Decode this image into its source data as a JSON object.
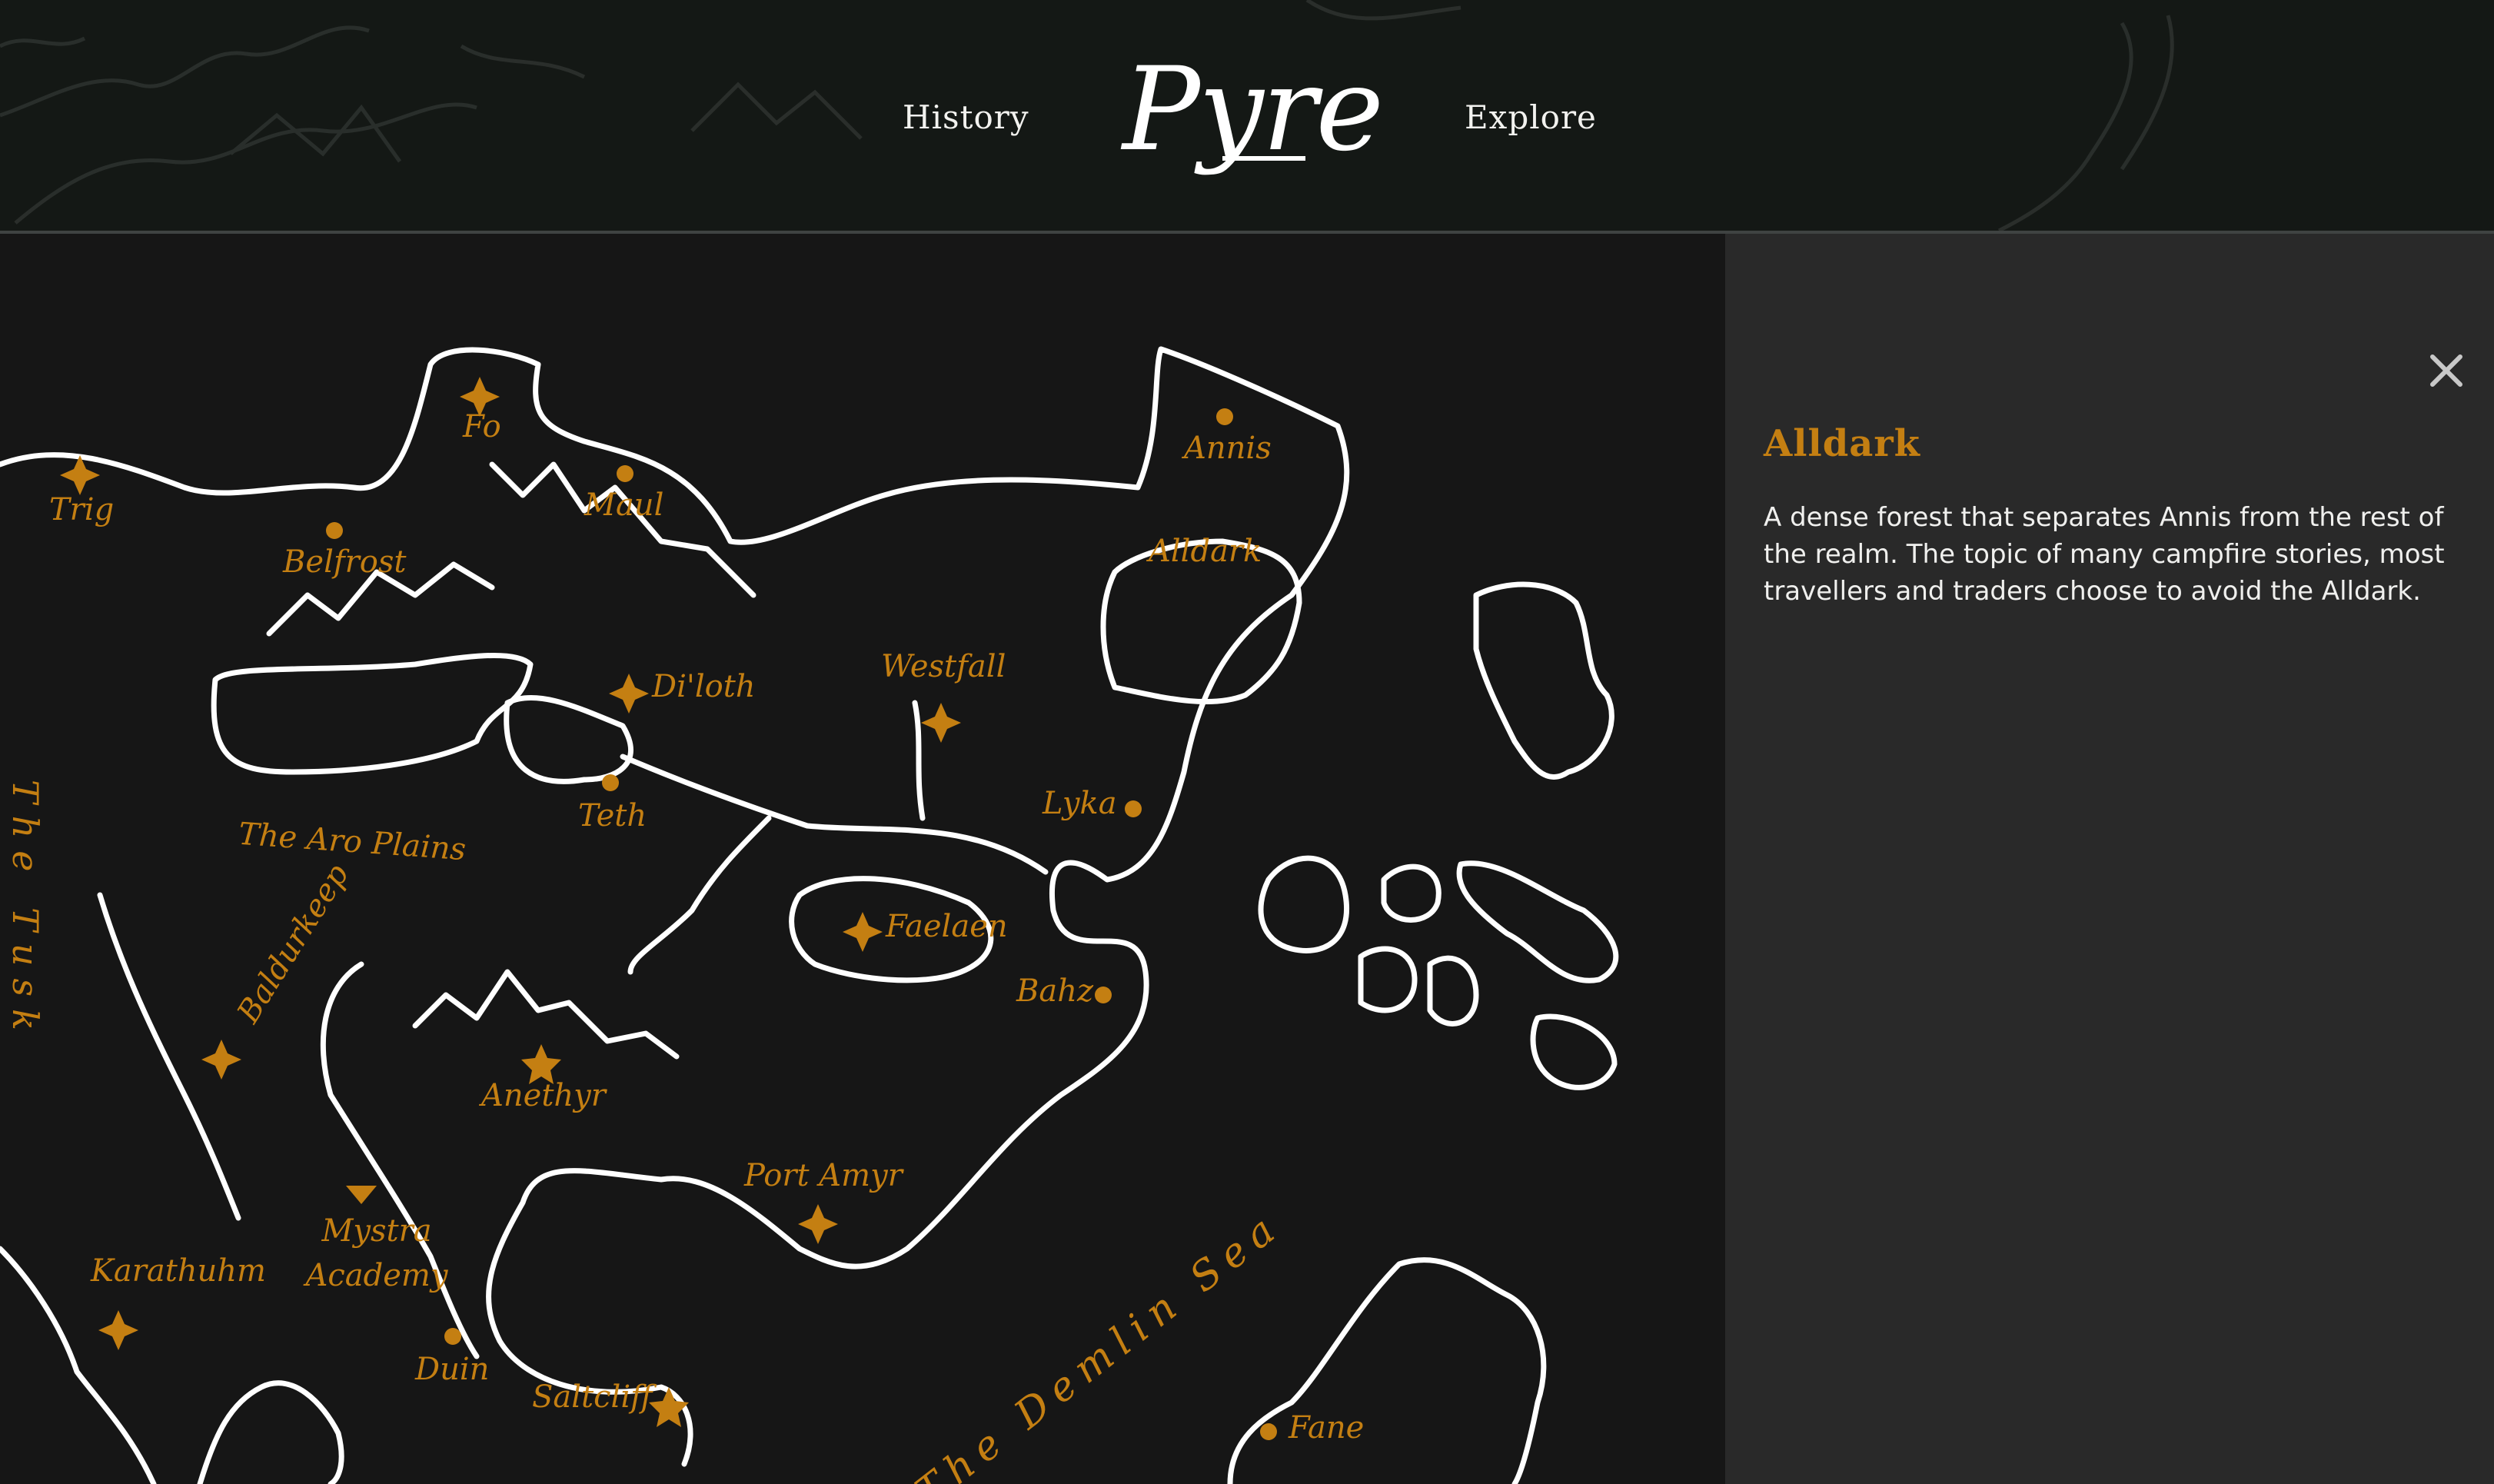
{
  "header": {
    "nav": {
      "history": "History",
      "explore": "Explore"
    },
    "logo": "Pyre"
  },
  "map": {
    "labels": {
      "trig": "Trig",
      "fo": "Fo",
      "maul": "Maul",
      "belfrost": "Belfrost",
      "annis": "Annis",
      "alldark": "Alldark",
      "diloth": "Di'loth",
      "westfall": "Westfall",
      "teth": "Teth",
      "lyka": "Lyka",
      "aro_plains": "The Aro Plains",
      "faelaen": "Faelaen",
      "bahz": "Bahz",
      "the_tusk": "The Tusk",
      "baldurkeep": "Baldurkeep",
      "anethyr": "Anethyr",
      "port_amyr": "Port Amyr",
      "mystra_academy": "Mystra Academy",
      "karathuhm": "Karathuhm",
      "duin": "Duin",
      "saltcliff": "Saltcliff",
      "demlin_sea": "The Demlin Sea",
      "fane": "Fane"
    },
    "colors": {
      "label": "#c47f12",
      "coast": "#ffffff",
      "background": "#161616"
    }
  },
  "panel": {
    "close_icon": "close-icon",
    "title": "Alldark",
    "description": "A dense forest that separates Annis from the rest of the realm. The topic of many campfire stories, most travellers and traders choose to avoid the Alldark."
  }
}
